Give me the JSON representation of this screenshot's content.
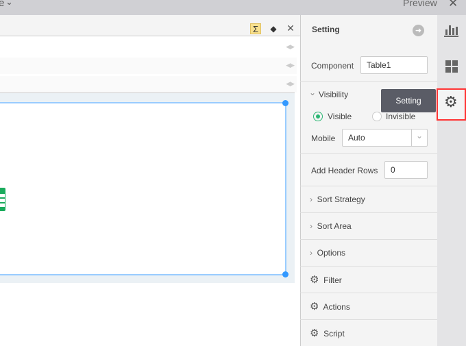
{
  "topbar": {
    "left_fragment": "e",
    "preview_label": "Preview"
  },
  "toolbar": {
    "icons": [
      "sigma-icon",
      "eraser-icon",
      "close-icon"
    ]
  },
  "panel": {
    "title": "Setting",
    "component_label": "Component",
    "component_value": "Table1",
    "visibility_label": "Visibility",
    "visible_label": "Visible",
    "invisible_label": "Invisible",
    "visibility_selected": "Visible",
    "mobile_label": "Mobile",
    "mobile_value": "Auto",
    "header_rows_label": "Add Header Rows",
    "header_rows_value": "0",
    "sections": [
      "Sort Strategy",
      "Sort Area",
      "Options"
    ],
    "actions": [
      "Filter",
      "Actions",
      "Script"
    ]
  },
  "tooltip": "Setting",
  "colors": {
    "accent": "#3399ff",
    "radio": "#2bb673",
    "highlight": "#ff3333",
    "tooltip_bg": "#5a5c66"
  }
}
